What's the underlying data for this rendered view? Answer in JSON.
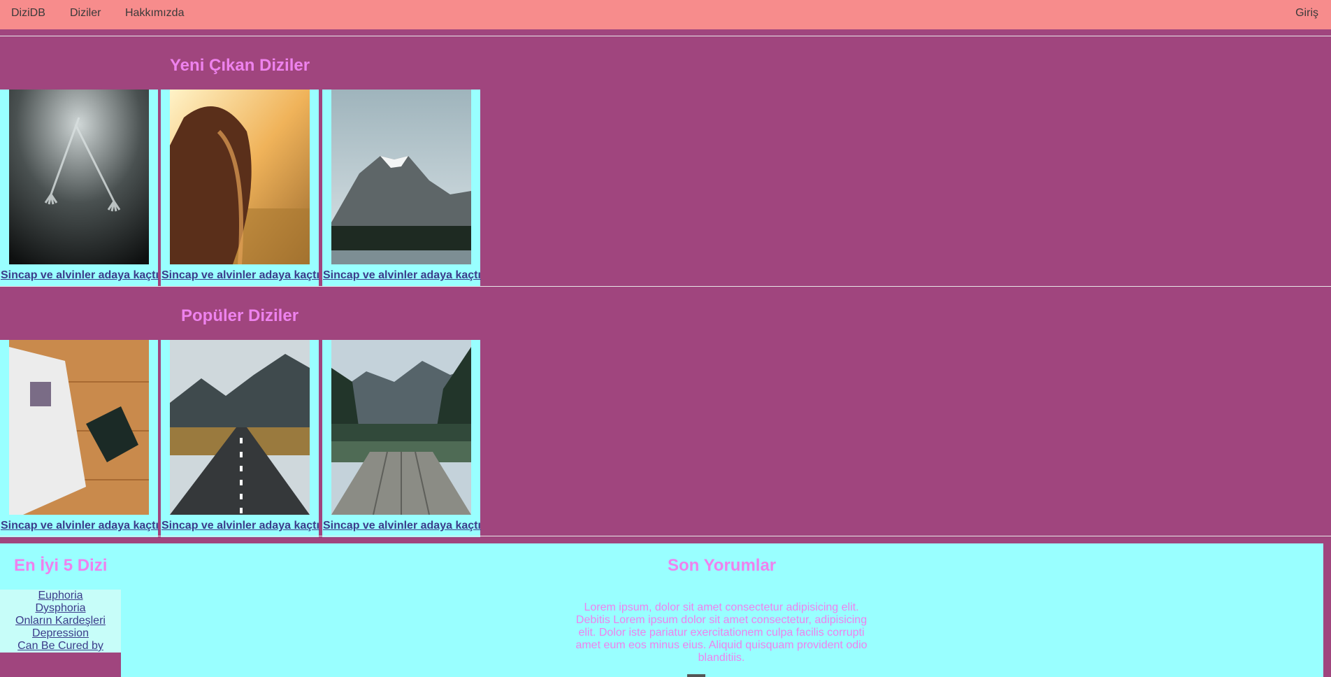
{
  "nav": {
    "brand": "DiziDB",
    "items": [
      "Diziler",
      "Hakkımızda"
    ],
    "login": "Giriş"
  },
  "new_series": {
    "title": "Yeni Çıkan Diziler",
    "cards": [
      {
        "image": "forks-photo",
        "caption": "Sincap ve alvinler adaya kaçtı"
      },
      {
        "image": "woman-hair-photo",
        "caption": "Sincap ve alvinler adaya kaçtı"
      },
      {
        "image": "snowy-mountain-photo",
        "caption": "Sincap ve alvinler adaya kaçtı"
      }
    ]
  },
  "popular_series": {
    "title": "Popüler Diziler",
    "cards": [
      {
        "image": "book-table-photo",
        "caption": "Sincap ve alvinler adaya kaçtı"
      },
      {
        "image": "road-mountains-photo",
        "caption": "Sincap ve alvinler adaya kaçtı"
      },
      {
        "image": "lake-dock-photo",
        "caption": "Sincap ve alvinler adaya kaçtı"
      }
    ]
  },
  "top5": {
    "title": "En İyi 5 Dizi",
    "items": [
      "Euphoria",
      "Dysphoria",
      "Onların Kardeşleri",
      "Depression",
      "Can Be Cured by What?"
    ]
  },
  "comments": {
    "title": "Son Yorumlar",
    "text": "Lorem ipsum, dolor sit amet consectetur adipisicing elit. Debitis Lorem ipsum dolor sit amet consectetur, adipisicing elit. Dolor iste pariatur exercitationem culpa facilis corrupti amet eum eos minus eius. Aliquid quisquam provident odio blanditiis."
  },
  "colors": {
    "navbar": "#f78c8c",
    "page": "#a0457e",
    "card": "#99ffff",
    "heading": "#ee82ee"
  }
}
